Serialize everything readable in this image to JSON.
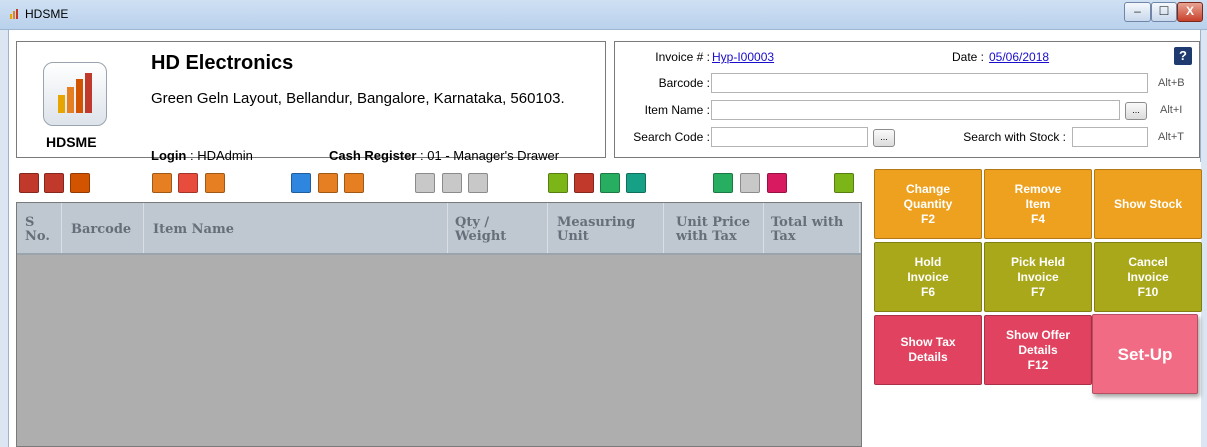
{
  "window": {
    "title": "HDSME",
    "minimize": "–",
    "maximize": "☐",
    "close": "X"
  },
  "company": {
    "logo_text": "HDSME",
    "name": "HD Electronics",
    "address": "Green Geln Layout, Bellandur, Bangalore, Karnataka, 560103.",
    "login_label": "Login",
    "login_value": "HDAdmin",
    "cash_register_label": "Cash Register",
    "cash_register_value": "01 - Manager's Drawer"
  },
  "invoice": {
    "invoice_label": "Invoice # :",
    "invoice_value": "Hyp-I00003",
    "date_label": "Date :",
    "date_value": "05/06/2018",
    "help": "?",
    "barcode_label": "Barcode :",
    "barcode_value": "",
    "barcode_hotkey": "Alt+B",
    "item_name_label": "Item Name :",
    "item_name_value": "",
    "item_name_hotkey": "Alt+I",
    "search_code_label": "Search Code :",
    "search_code_value": "",
    "search_stock_label": "Search with Stock :",
    "search_stock_value": "",
    "search_hotkey": "Alt+T",
    "browse": "..."
  },
  "toolbar": {
    "icons": [
      {
        "name": "report-icon",
        "color": "#c0392b"
      },
      {
        "name": "sales-report-icon",
        "color": "#c0392b"
      },
      {
        "name": "customer-report-icon",
        "color": "#d35400"
      },
      {
        "name": "edit-invoice-icon",
        "color": "#e67e22"
      },
      {
        "name": "cart-icon",
        "color": "#e74c3c"
      },
      {
        "name": "return-icon",
        "color": "#e67e22"
      },
      {
        "name": "stock-icon",
        "color": "#2e86de"
      },
      {
        "name": "notes-icon",
        "color": "#e67e22"
      },
      {
        "name": "delivery-icon",
        "color": "#e67e22"
      },
      {
        "name": "list-icon",
        "color": "#c8c8c8"
      },
      {
        "name": "ok-icon",
        "color": "#c8c8c8"
      },
      {
        "name": "clear-icon",
        "color": "#c8c8c8"
      },
      {
        "name": "calculator-icon",
        "color": "#7cb518"
      },
      {
        "name": "tax-icon",
        "color": "#c0392b"
      },
      {
        "name": "calculator2-icon",
        "color": "#27ae60"
      },
      {
        "name": "apps-icon",
        "color": "#16a085"
      },
      {
        "name": "user-icon",
        "color": "#27ae60"
      },
      {
        "name": "keypad-icon",
        "color": "#c8c8c8"
      },
      {
        "name": "key-icon",
        "color": "#d81b60"
      },
      {
        "name": "settings-icon",
        "color": "#7cb518"
      }
    ]
  },
  "grid": {
    "columns": [
      {
        "label": "S\nNo."
      },
      {
        "label": "Barcode"
      },
      {
        "label": "Item Name"
      },
      {
        "label": "Qty /\nWeight"
      },
      {
        "label": "Measuring\nUnit"
      },
      {
        "label": "Unit Price\nwith Tax"
      },
      {
        "label": "Total with\nTax"
      }
    ],
    "rows": []
  },
  "actions": {
    "change_quantity": "Change\nQuantity\nF2",
    "remove_item": "Remove\nItem\nF4",
    "show_stock": "Show Stock",
    "hold_invoice": "Hold\nInvoice\nF6",
    "pick_held_invoice": "Pick Held\nInvoice\nF7",
    "cancel_invoice": "Cancel\nInvoice\nF10",
    "show_tax_details": "Show Tax\nDetails",
    "show_offer_details": "Show Offer\nDetails\nF12",
    "setup": "Set-Up"
  },
  "colors": {
    "orange": "#eea11e",
    "olive": "#a9a81a",
    "red": "#e0425f",
    "setup": "#f06b83"
  }
}
